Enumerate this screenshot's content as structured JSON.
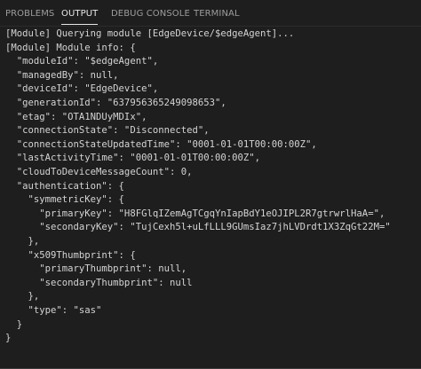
{
  "panel": {
    "tabs": [
      {
        "label": "PROBLEMS",
        "active": false
      },
      {
        "label": "OUTPUT",
        "active": true
      },
      {
        "label": "DEBUG CONSOLE",
        "active": false
      },
      {
        "label": "TERMINAL",
        "active": false
      }
    ],
    "colors": {
      "background": "#1e1e1e",
      "text": "#d4d4d4",
      "tab_inactive": "#9d9d9d",
      "tab_active": "#e7e7e7"
    }
  },
  "output": {
    "lines": [
      "[Module] Querying module [EdgeDevice/$edgeAgent]...",
      "[Module] Module info: {",
      "  \"moduleId\": \"$edgeAgent\",",
      "  \"managedBy\": null,",
      "  \"deviceId\": \"EdgeDevice\",",
      "  \"generationId\": \"637956365249098653\",",
      "  \"etag\": \"OTA1NDUyMDIx\",",
      "  \"connectionState\": \"Disconnected\",",
      "  \"connectionStateUpdatedTime\": \"0001-01-01T00:00:00Z\",",
      "  \"lastActivityTime\": \"0001-01-01T00:00:00Z\",",
      "  \"cloudToDeviceMessageCount\": 0,",
      "  \"authentication\": {",
      "    \"symmetricKey\": {",
      "      \"primaryKey\": \"H8FGlqIZemAgTCgqYnIapBdY1eOJIPL2R7gtrwrlHaA=\",",
      "      \"secondaryKey\": \"TujCexh5l+uLfLLL9GUmsIaz7jhLVDrdt1X3ZqGt22M=\"",
      "    },",
      "    \"x509Thumbprint\": {",
      "      \"primaryThumbprint\": null,",
      "      \"secondaryThumbprint\": null",
      "    },",
      "    \"type\": \"sas\"",
      "  }",
      "}"
    ]
  }
}
